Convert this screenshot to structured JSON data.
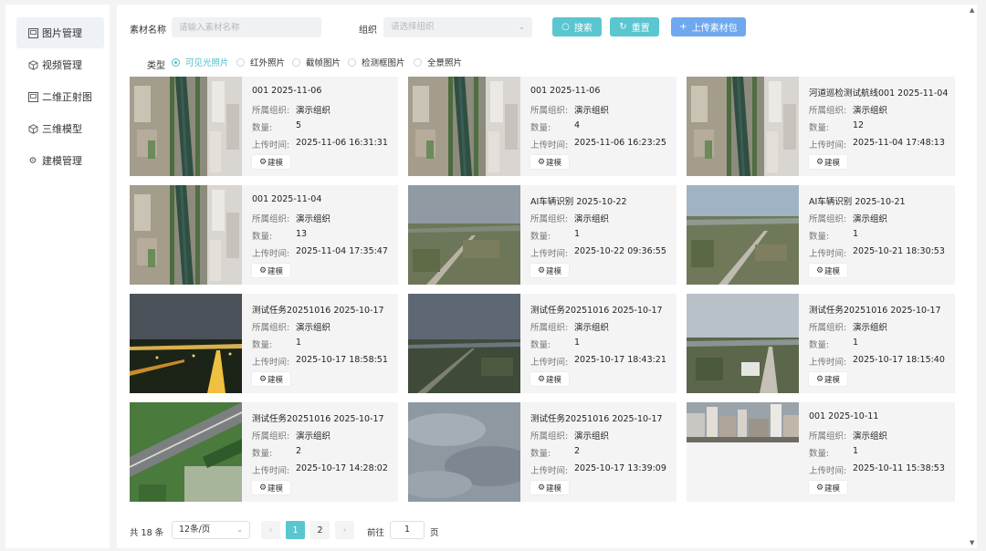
{
  "sidebar": {
    "items": [
      {
        "label": "图片管理",
        "icon": "image-icon",
        "active": true
      },
      {
        "label": "视频管理",
        "icon": "cube-icon",
        "active": false
      },
      {
        "label": "二维正射图",
        "icon": "image-icon",
        "active": false
      },
      {
        "label": "三维模型",
        "icon": "cube-icon",
        "active": false
      },
      {
        "label": "建模管理",
        "icon": "gear-icon",
        "active": false
      }
    ]
  },
  "filters": {
    "name_label": "素材名称",
    "name_placeholder": "请输入素材名称",
    "org_label": "组织",
    "org_placeholder": "请选择组织",
    "search_label": "搜索",
    "reset_label": "重置",
    "upload_label": "上传素材包",
    "type_label": "类型",
    "types": [
      "可见光照片",
      "红外照片",
      "截帧图片",
      "检测框图片",
      "全景照片"
    ],
    "selected_type": "可见光照片"
  },
  "cards": [
    {
      "title": "001 2025-11-06",
      "org_key": "所属组织:",
      "org": "演示组织",
      "count_key": "数量:",
      "count": "5",
      "time_key": "上传时间:",
      "time": "2025-11-06 16:31:31",
      "build": "建模",
      "scene": "aerial"
    },
    {
      "title": "001 2025-11-06",
      "org_key": "所属组织:",
      "org": "演示组织",
      "count_key": "数量:",
      "count": "4",
      "time_key": "上传时间:",
      "time": "2025-11-06 16:23:25",
      "build": "建模",
      "scene": "aerial"
    },
    {
      "title": "河道巡检测试航线001 2025-11-04",
      "org_key": "所属组织:",
      "org": "演示组织",
      "count_key": "数量:",
      "count": "12",
      "time_key": "上传时间:",
      "time": "2025-11-04 17:48:13",
      "build": "建模",
      "scene": "aerial"
    },
    {
      "title": "001 2025-11-04",
      "org_key": "所属组织:",
      "org": "演示组织",
      "count_key": "数量:",
      "count": "13",
      "time_key": "上传时间:",
      "time": "2025-11-04 17:35:47",
      "build": "建模",
      "scene": "aerial"
    },
    {
      "title": "AI车辆识别 2025-10-22",
      "org_key": "所属组织:",
      "org": "演示组织",
      "count_key": "数量:",
      "count": "1",
      "time_key": "上传时间:",
      "time": "2025-10-22 09:36:55",
      "build": "建模",
      "scene": "field"
    },
    {
      "title": "AI车辆识别 2025-10-21",
      "org_key": "所属组织:",
      "org": "演示组织",
      "count_key": "数量:",
      "count": "1",
      "time_key": "上传时间:",
      "time": "2025-10-21 18:30:53",
      "build": "建模",
      "scene": "field2"
    },
    {
      "title": "测试任务20251016 2025-10-17",
      "org_key": "所属组织:",
      "org": "演示组织",
      "count_key": "数量:",
      "count": "1",
      "time_key": "上传时间:",
      "time": "2025-10-17 18:58:51",
      "build": "建模",
      "scene": "night"
    },
    {
      "title": "测试任务20251016 2025-10-17",
      "org_key": "所属组织:",
      "org": "演示组织",
      "count_key": "数量:",
      "count": "1",
      "time_key": "上传时间:",
      "time": "2025-10-17 18:43:21",
      "build": "建模",
      "scene": "dusk"
    },
    {
      "title": "测试任务20251016 2025-10-17",
      "org_key": "所属组织:",
      "org": "演示组织",
      "count_key": "数量:",
      "count": "1",
      "time_key": "上传时间:",
      "time": "2025-10-17 18:15:40",
      "build": "建模",
      "scene": "cloudy"
    },
    {
      "title": "测试任务20251016 2025-10-17",
      "org_key": "所属组织:",
      "org": "演示组织",
      "count_key": "数量:",
      "count": "2",
      "time_key": "上传时间:",
      "time": "2025-10-17 14:28:02",
      "build": "建模",
      "scene": "road"
    },
    {
      "title": "测试任务20251016 2025-10-17",
      "org_key": "所属组织:",
      "org": "演示组织",
      "count_key": "数量:",
      "count": "2",
      "time_key": "上传时间:",
      "time": "2025-10-17 13:39:09",
      "build": "建模",
      "scene": "sky"
    },
    {
      "title": "001 2025-10-11",
      "org_key": "所属组织:",
      "org": "演示组织",
      "count_key": "数量:",
      "count": "1",
      "time_key": "上传时间:",
      "time": "2025-10-11 15:38:53",
      "build": "建模",
      "scene": "city"
    }
  ],
  "pager": {
    "total": "共 18 条",
    "page_size": "12条/页",
    "pages": [
      "1",
      "2"
    ],
    "current": "1",
    "goto_label": "前往",
    "goto_value": "1",
    "goto_unit": "页",
    "prev": "‹",
    "next": "›"
  },
  "colors": {
    "accent": "#5ac6cf",
    "upload": "#6fa8ee"
  }
}
